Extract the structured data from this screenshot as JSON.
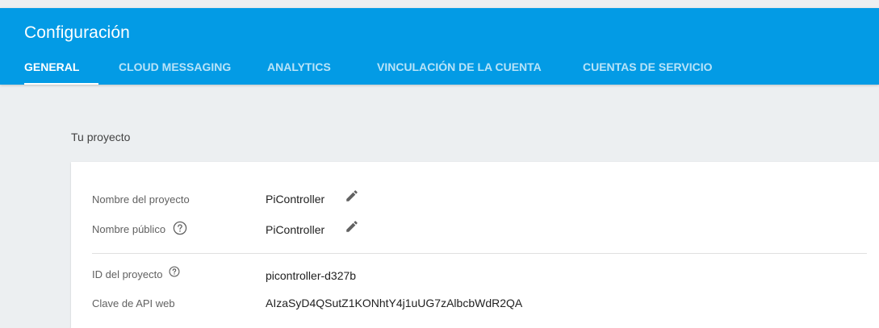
{
  "header": {
    "title": "Configuración",
    "background_color": "#039be5"
  },
  "tabs": [
    {
      "label": "GENERAL",
      "active": true
    },
    {
      "label": "CLOUD MESSAGING",
      "active": false
    },
    {
      "label": "ANALYTICS",
      "active": false
    },
    {
      "label": "VINCULACIÓN DE LA CUENTA",
      "active": false
    },
    {
      "label": "CUENTAS DE SERVICIO",
      "active": false
    }
  ],
  "project": {
    "section_title": "Tu proyecto",
    "fields": {
      "project_name": {
        "label": "Nombre del proyecto",
        "value": "PiController",
        "icon": "pencil-icon"
      },
      "public_name": {
        "label": "Nombre público",
        "value": "PiController",
        "icon": "pencil-icon",
        "help_icon": "help-circle-icon"
      },
      "project_id": {
        "label": "ID del proyecto",
        "value": "picontroller-d327b",
        "help_icon": "help-circle-icon"
      },
      "web_api_key": {
        "label": "Clave de API web",
        "value": "AIzaSyD4QSutZ1KONhtY4j1uUG7zAlbcbWdR2QA"
      }
    }
  }
}
